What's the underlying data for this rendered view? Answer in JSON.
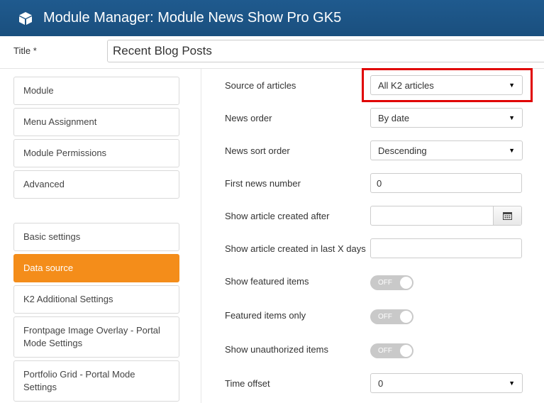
{
  "header": {
    "icon": "cube-icon",
    "title": "Module Manager: Module News Show Pro GK5",
    "background": "#1f5a8e"
  },
  "title_field": {
    "label": "Title *",
    "value": "Recent Blog Posts"
  },
  "sidebar": {
    "items": [
      {
        "label": "Module"
      },
      {
        "label": "Menu Assignment"
      },
      {
        "label": "Module Permissions"
      },
      {
        "label": "Advanced"
      },
      {
        "label": "Basic settings"
      },
      {
        "label": "Data source",
        "active": true
      },
      {
        "label": "K2 Additional Settings"
      },
      {
        "label": "Frontpage Image Overlay - Portal Mode Settings"
      },
      {
        "label": "Portfolio Grid - Portal Mode Settings"
      }
    ],
    "active_color": "#f48d1a"
  },
  "form": {
    "source_of_articles": {
      "label": "Source of articles",
      "value": "All K2 articles"
    },
    "news_order": {
      "label": "News order",
      "value": "By date"
    },
    "news_sort_order": {
      "label": "News sort order",
      "value": "Descending"
    },
    "first_news_number": {
      "label": "First news number",
      "value": "0"
    },
    "created_after": {
      "label": "Show article created after",
      "value": ""
    },
    "created_last_x_days": {
      "label": "Show article created in last X days",
      "value": ""
    },
    "show_featured": {
      "label": "Show featured items",
      "state": "OFF"
    },
    "featured_only": {
      "label": "Featured items only",
      "state": "OFF"
    },
    "show_unauthorized": {
      "label": "Show unauthorized items",
      "state": "OFF"
    },
    "time_offset": {
      "label": "Time offset",
      "value": "0"
    }
  },
  "highlight_color": "#e00000"
}
